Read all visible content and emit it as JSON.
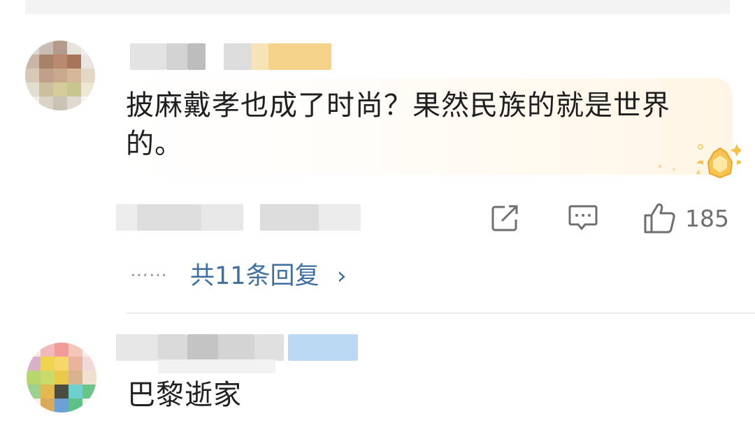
{
  "comments": [
    {
      "text": "披麻戴孝也成了时尚？果然民族的就是世界的。",
      "actions": {
        "share_icon": "share-icon",
        "comment_icon": "comment-icon",
        "like_icon": "thumbs-up-icon",
        "like_count": "185"
      },
      "replies": {
        "dots": "……",
        "label": "共11条回复",
        "arrow": "›"
      }
    },
    {
      "text": "巴黎逝家"
    }
  ],
  "colors": {
    "reply_link": "#3f6f9f",
    "like_count": "#6f6f6f",
    "highlight_bg": "#fff5e5",
    "divider": "#ececec"
  }
}
